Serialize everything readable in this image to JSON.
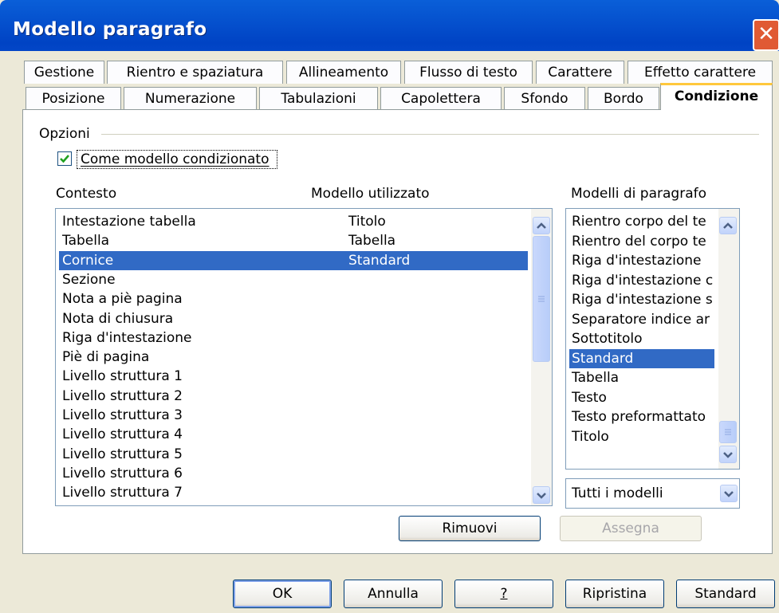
{
  "window": {
    "title": "Modello paragrafo",
    "close_glyph": "✕"
  },
  "tabs": {
    "row1": [
      "Gestione",
      "Rientro e spaziatura",
      "Allineamento",
      "Flusso di testo",
      "Carattere",
      "Effetto carattere"
    ],
    "row2": [
      "Posizione",
      "Numerazione",
      "Tabulazioni",
      "Capolettera",
      "Sfondo",
      "Bordo",
      "Condizione"
    ],
    "active": "Condizione"
  },
  "options": {
    "group_label": "Opzioni",
    "checkbox_label": "Come modello condizionato",
    "checked": true
  },
  "headers": {
    "context": "Contesto",
    "used_style": "Modello utilizzato",
    "paragraph_styles": "Modelli di paragrafo"
  },
  "context_list": {
    "rows": [
      {
        "context": "Intestazione tabella",
        "style": "Titolo"
      },
      {
        "context": "Tabella",
        "style": "Tabella"
      },
      {
        "context": "Cornice",
        "style": "Standard"
      },
      {
        "context": "Sezione",
        "style": ""
      },
      {
        "context": "Nota a piè pagina",
        "style": ""
      },
      {
        "context": "Nota di chiusura",
        "style": ""
      },
      {
        "context": "Riga d'intestazione",
        "style": ""
      },
      {
        "context": "Piè di pagina",
        "style": ""
      },
      {
        "context": "Livello struttura 1",
        "style": ""
      },
      {
        "context": "Livello struttura 2",
        "style": ""
      },
      {
        "context": "Livello struttura 3",
        "style": ""
      },
      {
        "context": "Livello struttura 4",
        "style": ""
      },
      {
        "context": "Livello struttura 5",
        "style": ""
      },
      {
        "context": "Livello struttura 6",
        "style": ""
      },
      {
        "context": "Livello struttura 7",
        "style": ""
      }
    ],
    "selected_index": 2
  },
  "styles_list": {
    "items": [
      "Rientro corpo del te",
      "Rientro del corpo te",
      "Riga d'intestazione",
      "Riga d'intestazione c",
      "Riga d'intestazione s",
      "Separatore indice ar",
      "Sottotitolo",
      "Standard",
      "Tabella",
      "Testo",
      "Testo preformattato",
      "Titolo"
    ],
    "selected_index": 7
  },
  "filter": {
    "value": "Tutti i modelli"
  },
  "buttons": {
    "remove": "Rimuovi",
    "assign": "Assegna",
    "ok": "OK",
    "cancel": "Annulla",
    "help": "?",
    "reset": "Ripristina",
    "standard": "Standard"
  },
  "colors": {
    "selection": "#316ac5",
    "titlebar": "#0043c4",
    "tab_highlight": "#ffc83c"
  }
}
